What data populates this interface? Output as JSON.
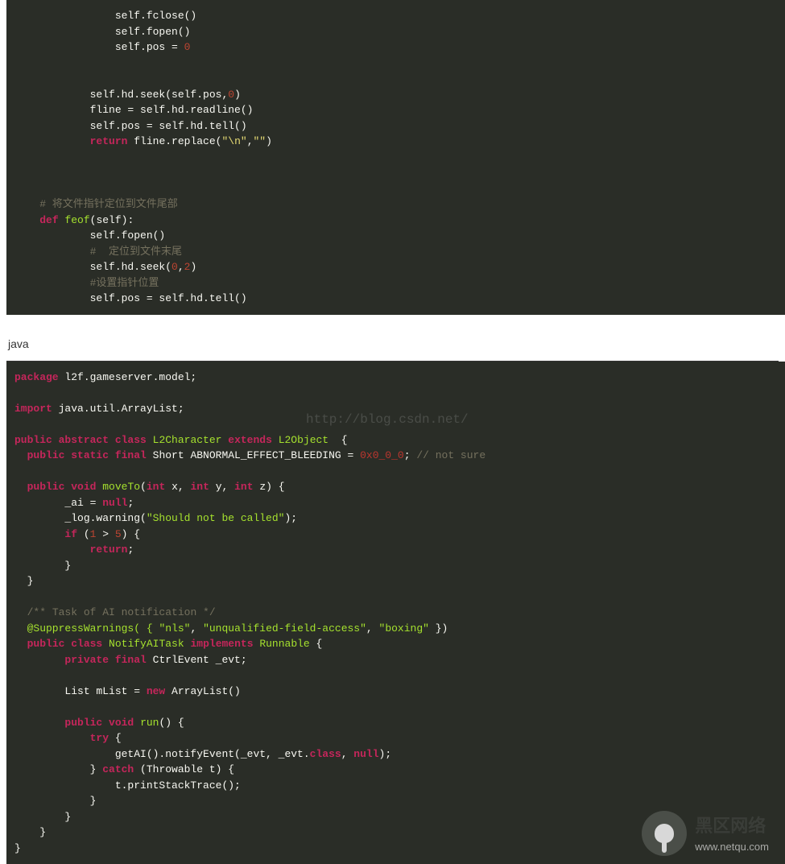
{
  "python": {
    "l1": "                self.fclose()",
    "l2": "                self.fopen()",
    "l3a": "                self.pos = ",
    "l3b": "0",
    "l5a": "            self.hd.seek(self.pos,",
    "l5b": "0",
    "l5c": ")",
    "l6": "            fline = self.hd.readline()",
    "l7": "            self.pos = self.hd.tell()",
    "l8a": "            ",
    "l8kw": "return",
    "l8b": " fline.replace(",
    "l8s1": "\"\\n\"",
    "l8c": ",",
    "l8s2": "\"\"",
    "l8d": ")",
    "l11cmt": "    # 将文件指针定位到文件尾部",
    "l12a": "    ",
    "l12kw": "def",
    "l12b": " ",
    "l12fn": "feof",
    "l12c": "(self):",
    "l13": "            self.fopen()",
    "l14cmt": "            #  定位到文件末尾",
    "l15a": "            self.hd.seek(",
    "l15n1": "0",
    "l15b": ",",
    "l15n2": "2",
    "l15c": ")",
    "l16cmt": "            #设置指针位置",
    "l17": "            self.pos = self.hd.tell()"
  },
  "label": {
    "java": "java"
  },
  "wm": {
    "url": "http://blog.csdn.net/"
  },
  "java": {
    "l1a": "package",
    "l1b": " l2f.gameserver.model;",
    "l3a": "import",
    "l3b": " java.util.ArrayList;",
    "l5a": "public abstract class",
    "l5b": " ",
    "l5c": "L2Character",
    "l5d": " ",
    "l5e": "extends",
    "l5f": " ",
    "l5g": "L2Object",
    "l5h": "  {",
    "l6a": "  ",
    "l6b": "public static final",
    "l6c": " Short ABNORMAL_EFFECT_BLEEDING = ",
    "l6d": "0x0_0_0",
    "l6e": "; ",
    "l6f": "// not sure",
    "l8a": "  ",
    "l8b": "public void",
    "l8c": " ",
    "l8d": "moveTo",
    "l8e": "(",
    "l8f": "int",
    "l8g": " x, ",
    "l8h": "int",
    "l8i": " y, ",
    "l8j": "int",
    "l8k": " z) {",
    "l9a": "        _ai = ",
    "l9b": "null",
    "l9c": ";",
    "l10a": "        _log.warning(",
    "l10b": "\"Should not be called\"",
    "l10c": ");",
    "l11a": "        ",
    "l11b": "if",
    "l11c": " (",
    "l11d": "1",
    "l11e": " > ",
    "l11f": "5",
    "l11g": ") {",
    "l12a": "            ",
    "l12b": "return",
    "l12c": ";",
    "l13": "        }",
    "l14": "  }",
    "l16a": "  ",
    "l16b": "/** Task of AI notification */",
    "l17a": "  @SuppressWarnings( { ",
    "l17b": "\"nls\"",
    "l17c": ", ",
    "l17d": "\"unqualified-field-access\"",
    "l17e": ", ",
    "l17f": "\"boxing\"",
    "l17g": " })",
    "l18a": "  ",
    "l18b": "public class",
    "l18c": " ",
    "l18d": "NotifyAITask",
    "l18e": " ",
    "l18f": "implements",
    "l18g": " ",
    "l18h": "Runnable",
    "l18i": " {",
    "l19a": "        ",
    "l19b": "private final",
    "l19c": " CtrlEvent _evt;",
    "l21a": "        List mList = ",
    "l21b": "new",
    "l21c": " ArrayList()",
    "l23a": "        ",
    "l23b": "public void",
    "l23c": " ",
    "l23d": "run",
    "l23e": "() {",
    "l24a": "            ",
    "l24b": "try",
    "l24c": " {",
    "l25a": "                getAI().notifyEvent(_evt, _evt.",
    "l25b": "class",
    "l25c": ", ",
    "l25d": "null",
    "l25e": ");",
    "l26a": "            } ",
    "l26b": "catch",
    "l26c": " (Throwable t) {",
    "l27": "                t.printStackTrace();",
    "l28": "            }",
    "l29": "        }",
    "l30": "    }",
    "l31": "}"
  },
  "footer": {
    "top": "黑区网络",
    "bot": "www.netqu.com"
  }
}
